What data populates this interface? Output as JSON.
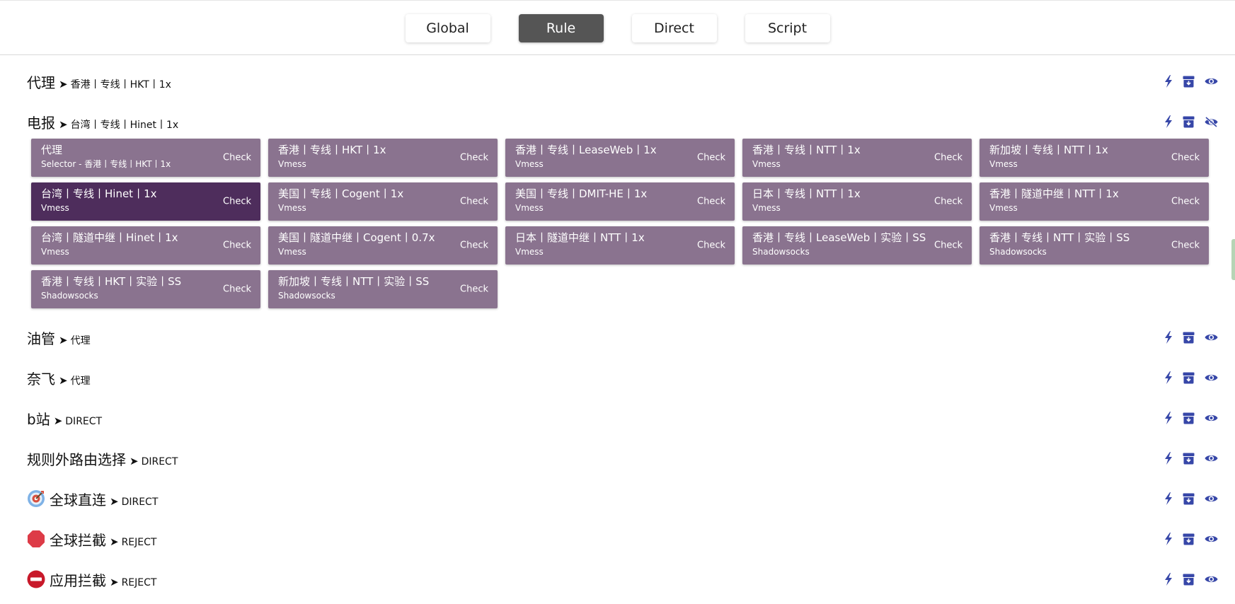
{
  "modes": [
    "Global",
    "Rule",
    "Direct",
    "Script"
  ],
  "active_mode": "Rule",
  "arrow": "➤",
  "check_label": "Check",
  "colors": {
    "accent": "#3747a8",
    "proxy_card": "#8a738f",
    "proxy_card_selected": "#4e2d5c",
    "active_mode_bg": "#555555"
  },
  "groups": [
    {
      "name": "代理",
      "now": "香港丨专线丨HKT丨1x",
      "visibility": "eye-icon"
    },
    {
      "name": "电报",
      "now": "台湾丨专线丨Hinet丨1x",
      "visibility": "eye-off-icon",
      "expanded": true
    },
    {
      "name": "油管",
      "now": "代理",
      "visibility": "eye-icon"
    },
    {
      "name": "奈飞",
      "now": "代理",
      "visibility": "eye-icon"
    },
    {
      "name": "b站",
      "now": "DIRECT",
      "visibility": "eye-icon"
    },
    {
      "name": "规则外路由选择",
      "now": "DIRECT",
      "visibility": "eye-icon"
    },
    {
      "name": "全球直连",
      "now": "DIRECT",
      "icon": "target-emoji-icon",
      "visibility": "eye-icon"
    },
    {
      "name": "全球拦截",
      "now": "REJECT",
      "icon": "stop-sign-emoji-icon",
      "visibility": "eye-icon"
    },
    {
      "name": "应用拦截",
      "now": "REJECT",
      "icon": "no-entry-emoji-icon",
      "visibility": "eye-icon"
    }
  ],
  "proxies": [
    {
      "name": "代理",
      "type": "Selector - 香港丨专线丨HKT丨1x"
    },
    {
      "name": "香港丨专线丨HKT丨1x",
      "type": "Vmess"
    },
    {
      "name": "香港丨专线丨LeaseWeb丨1x",
      "type": "Vmess"
    },
    {
      "name": "香港丨专线丨NTT丨1x",
      "type": "Vmess"
    },
    {
      "name": "新加坡丨专线丨NTT丨1x",
      "type": "Vmess"
    },
    {
      "name": "台湾丨专线丨Hinet丨1x",
      "type": "Vmess",
      "selected": true
    },
    {
      "name": "美国丨专线丨Cogent丨1x",
      "type": "Vmess"
    },
    {
      "name": "美国丨专线丨DMIT-HE丨1x",
      "type": "Vmess"
    },
    {
      "name": "日本丨专线丨NTT丨1x",
      "type": "Vmess"
    },
    {
      "name": "香港丨隧道中继丨NTT丨1x",
      "type": "Vmess"
    },
    {
      "name": "台湾丨隧道中继丨Hinet丨1x",
      "type": "Vmess"
    },
    {
      "name": "美国丨隧道中继丨Cogent丨0.7x",
      "type": "Vmess"
    },
    {
      "name": "日本丨隧道中继丨NTT丨1x",
      "type": "Vmess"
    },
    {
      "name": "香港丨专线丨LeaseWeb丨实验丨SS",
      "type": "Shadowsocks"
    },
    {
      "name": "香港丨专线丨NTT丨实验丨SS",
      "type": "Shadowsocks"
    },
    {
      "name": "香港丨专线丨HKT丨实验丨SS",
      "type": "Shadowsocks"
    },
    {
      "name": "新加坡丨专线丨NTT丨实验丨SS",
      "type": "Shadowsocks"
    }
  ]
}
